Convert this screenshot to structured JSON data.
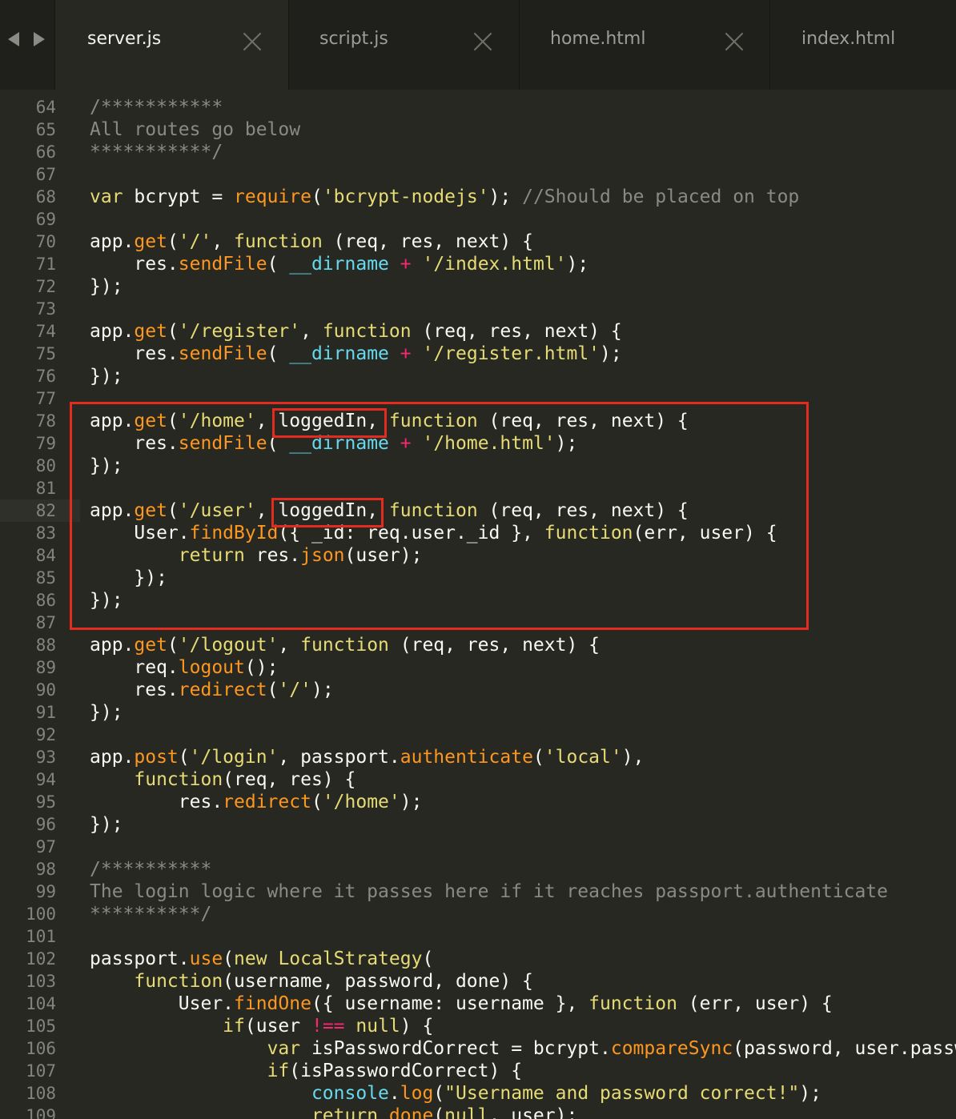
{
  "nav": {
    "back": "back-arrow-icon",
    "forward": "forward-arrow-icon"
  },
  "tabs": [
    {
      "label": "server.js",
      "active": true
    },
    {
      "label": "script.js",
      "active": false
    },
    {
      "label": "home.html",
      "active": false
    },
    {
      "label": "index.html",
      "active": false
    }
  ],
  "highlight_color": "#e32b20",
  "current_line": 82,
  "lines": [
    {
      "n": 64,
      "segs": [
        [
          "c",
          "/***********"
        ]
      ]
    },
    {
      "n": 65,
      "segs": [
        [
          "c",
          "All routes go below"
        ]
      ]
    },
    {
      "n": 66,
      "segs": [
        [
          "c",
          "***********/"
        ]
      ]
    },
    {
      "n": 67,
      "segs": []
    },
    {
      "n": 68,
      "segs": [
        [
          "k",
          "var"
        ],
        [
          "p",
          " bcrypt = "
        ],
        [
          "f",
          "require"
        ],
        [
          "p",
          "("
        ],
        [
          "s",
          "'bcrypt-nodejs'"
        ],
        [
          "p",
          "); "
        ],
        [
          "c",
          "//Should be placed on top"
        ]
      ]
    },
    {
      "n": 69,
      "segs": []
    },
    {
      "n": 70,
      "segs": [
        [
          "p",
          "app."
        ],
        [
          "f",
          "get"
        ],
        [
          "p",
          "("
        ],
        [
          "s",
          "'/'"
        ],
        [
          "p",
          ", "
        ],
        [
          "k",
          "function"
        ],
        [
          "p",
          " (req, res, next) {"
        ]
      ]
    },
    {
      "n": 71,
      "segs": [
        [
          "p",
          "    res."
        ],
        [
          "f",
          "sendFile"
        ],
        [
          "p",
          "( "
        ],
        [
          "v",
          "__dirname"
        ],
        [
          "p",
          " "
        ],
        [
          "o",
          "+"
        ],
        [
          "p",
          " "
        ],
        [
          "s",
          "'/index.html'"
        ],
        [
          "p",
          ");"
        ]
      ]
    },
    {
      "n": 72,
      "segs": [
        [
          "p",
          "});"
        ]
      ]
    },
    {
      "n": 73,
      "segs": []
    },
    {
      "n": 74,
      "segs": [
        [
          "p",
          "app."
        ],
        [
          "f",
          "get"
        ],
        [
          "p",
          "("
        ],
        [
          "s",
          "'/register'"
        ],
        [
          "p",
          ", "
        ],
        [
          "k",
          "function"
        ],
        [
          "p",
          " (req, res, next) {"
        ]
      ]
    },
    {
      "n": 75,
      "segs": [
        [
          "p",
          "    res."
        ],
        [
          "f",
          "sendFile"
        ],
        [
          "p",
          "( "
        ],
        [
          "v",
          "__dirname"
        ],
        [
          "p",
          " "
        ],
        [
          "o",
          "+"
        ],
        [
          "p",
          " "
        ],
        [
          "s",
          "'/register.html'"
        ],
        [
          "p",
          ");"
        ]
      ]
    },
    {
      "n": 76,
      "segs": [
        [
          "p",
          "});"
        ]
      ]
    },
    {
      "n": 77,
      "segs": []
    },
    {
      "n": 78,
      "segs": [
        [
          "p",
          "app."
        ],
        [
          "f",
          "get"
        ],
        [
          "p",
          "("
        ],
        [
          "s",
          "'/home'"
        ],
        [
          "p",
          ", loggedIn, "
        ],
        [
          "k",
          "function"
        ],
        [
          "p",
          " (req, res, next) {"
        ]
      ]
    },
    {
      "n": 79,
      "segs": [
        [
          "p",
          "    res."
        ],
        [
          "f",
          "sendFile"
        ],
        [
          "p",
          "( "
        ],
        [
          "v",
          "__dirname"
        ],
        [
          "p",
          " "
        ],
        [
          "o",
          "+"
        ],
        [
          "p",
          " "
        ],
        [
          "s",
          "'/home.html'"
        ],
        [
          "p",
          ");"
        ]
      ]
    },
    {
      "n": 80,
      "segs": [
        [
          "p",
          "});"
        ]
      ]
    },
    {
      "n": 81,
      "segs": []
    },
    {
      "n": 82,
      "segs": [
        [
          "p",
          "app."
        ],
        [
          "f",
          "get"
        ],
        [
          "p",
          "("
        ],
        [
          "s",
          "'/user'"
        ],
        [
          "p",
          ", loggedIn, "
        ],
        [
          "k",
          "function"
        ],
        [
          "p",
          " (req, res, next) {"
        ]
      ]
    },
    {
      "n": 83,
      "segs": [
        [
          "p",
          "    User."
        ],
        [
          "f",
          "findById"
        ],
        [
          "p",
          "({ _id: req.user._id }, "
        ],
        [
          "k",
          "function"
        ],
        [
          "p",
          "(err, user) {"
        ]
      ]
    },
    {
      "n": 84,
      "segs": [
        [
          "p",
          "        "
        ],
        [
          "k",
          "return"
        ],
        [
          "p",
          " res."
        ],
        [
          "f",
          "json"
        ],
        [
          "p",
          "(user);"
        ]
      ]
    },
    {
      "n": 85,
      "segs": [
        [
          "p",
          "    });"
        ]
      ]
    },
    {
      "n": 86,
      "segs": [
        [
          "p",
          "});"
        ]
      ]
    },
    {
      "n": 87,
      "segs": []
    },
    {
      "n": 88,
      "segs": [
        [
          "p",
          "app."
        ],
        [
          "f",
          "get"
        ],
        [
          "p",
          "("
        ],
        [
          "s",
          "'/logout'"
        ],
        [
          "p",
          ", "
        ],
        [
          "k",
          "function"
        ],
        [
          "p",
          " (req, res, next) {"
        ]
      ]
    },
    {
      "n": 89,
      "segs": [
        [
          "p",
          "    req."
        ],
        [
          "f",
          "logout"
        ],
        [
          "p",
          "();"
        ]
      ]
    },
    {
      "n": 90,
      "segs": [
        [
          "p",
          "    res."
        ],
        [
          "f",
          "redirect"
        ],
        [
          "p",
          "("
        ],
        [
          "s",
          "'/'"
        ],
        [
          "p",
          ");"
        ]
      ]
    },
    {
      "n": 91,
      "segs": [
        [
          "p",
          "});"
        ]
      ]
    },
    {
      "n": 92,
      "segs": []
    },
    {
      "n": 93,
      "segs": [
        [
          "p",
          "app."
        ],
        [
          "f",
          "post"
        ],
        [
          "p",
          "("
        ],
        [
          "s",
          "'/login'"
        ],
        [
          "p",
          ", passport."
        ],
        [
          "f",
          "authenticate"
        ],
        [
          "p",
          "("
        ],
        [
          "s",
          "'local'"
        ],
        [
          "p",
          "),"
        ]
      ]
    },
    {
      "n": 94,
      "segs": [
        [
          "p",
          "    "
        ],
        [
          "k",
          "function"
        ],
        [
          "p",
          "(req, res) {"
        ]
      ]
    },
    {
      "n": 95,
      "segs": [
        [
          "p",
          "        res."
        ],
        [
          "f",
          "redirect"
        ],
        [
          "p",
          "("
        ],
        [
          "s",
          "'/home'"
        ],
        [
          "p",
          ");"
        ]
      ]
    },
    {
      "n": 96,
      "segs": [
        [
          "p",
          "});"
        ]
      ]
    },
    {
      "n": 97,
      "segs": []
    },
    {
      "n": 98,
      "segs": [
        [
          "c",
          "/**********"
        ]
      ]
    },
    {
      "n": 99,
      "segs": [
        [
          "c",
          "The login logic where it passes here if it reaches passport.authenticate"
        ]
      ]
    },
    {
      "n": 100,
      "segs": [
        [
          "c",
          "**********/"
        ]
      ]
    },
    {
      "n": 101,
      "segs": []
    },
    {
      "n": 102,
      "segs": [
        [
          "p",
          "passport."
        ],
        [
          "f",
          "use"
        ],
        [
          "p",
          "("
        ],
        [
          "k",
          "new"
        ],
        [
          "p",
          " "
        ],
        [
          "k",
          "LocalStrategy"
        ],
        [
          "p",
          "("
        ]
      ]
    },
    {
      "n": 103,
      "segs": [
        [
          "p",
          "    "
        ],
        [
          "k",
          "function"
        ],
        [
          "p",
          "(username, password, done) {"
        ]
      ]
    },
    {
      "n": 104,
      "segs": [
        [
          "p",
          "        User."
        ],
        [
          "f",
          "findOne"
        ],
        [
          "p",
          "({ username: username }, "
        ],
        [
          "k",
          "function"
        ],
        [
          "p",
          " (err, user) {"
        ]
      ]
    },
    {
      "n": 105,
      "segs": [
        [
          "p",
          "            "
        ],
        [
          "k",
          "if"
        ],
        [
          "p",
          "(user "
        ],
        [
          "o",
          "!=="
        ],
        [
          "p",
          " "
        ],
        [
          "k",
          "null"
        ],
        [
          "p",
          ") {"
        ]
      ]
    },
    {
      "n": 106,
      "segs": [
        [
          "p",
          "                "
        ],
        [
          "k",
          "var"
        ],
        [
          "p",
          " isPasswordCorrect = bcrypt."
        ],
        [
          "f",
          "compareSync"
        ],
        [
          "p",
          "(password, user.password);"
        ]
      ]
    },
    {
      "n": 107,
      "segs": [
        [
          "p",
          "                "
        ],
        [
          "k",
          "if"
        ],
        [
          "p",
          "(isPasswordCorrect) {"
        ]
      ]
    },
    {
      "n": 108,
      "segs": [
        [
          "p",
          "                    "
        ],
        [
          "v",
          "console"
        ],
        [
          "p",
          "."
        ],
        [
          "f",
          "log"
        ],
        [
          "p",
          "("
        ],
        [
          "s",
          "\"Username and password correct!\""
        ],
        [
          "p",
          ");"
        ]
      ]
    },
    {
      "n": 109,
      "segs": [
        [
          "p",
          "                    "
        ],
        [
          "k",
          "return"
        ],
        [
          "p",
          " "
        ],
        [
          "f",
          "done"
        ],
        [
          "p",
          "("
        ],
        [
          "k",
          "null"
        ],
        [
          "p",
          ", user);"
        ]
      ]
    }
  ]
}
